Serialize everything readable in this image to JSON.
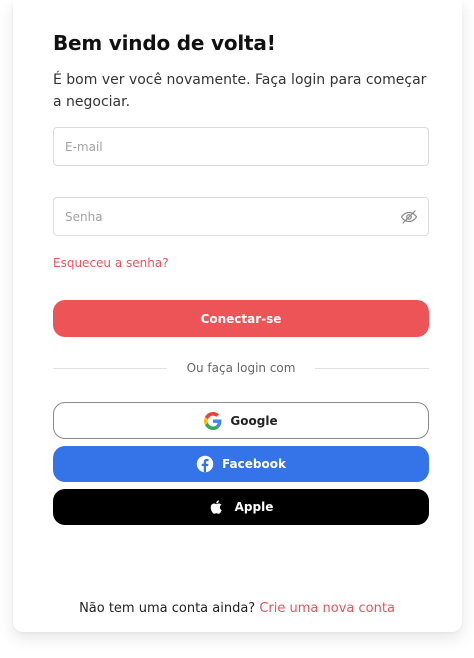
{
  "header": {
    "title": "Bem vindo de volta!",
    "subtitle": "É bom ver você novamente. Faça login para começar a negociar."
  },
  "form": {
    "email": {
      "placeholder": "E-mail",
      "value": ""
    },
    "password": {
      "placeholder": "Senha",
      "value": ""
    },
    "forgot_label": "Esqueceu a senha?",
    "connect_label": "Conectar-se"
  },
  "social": {
    "divider_label": "Ou faça login com",
    "google_label": "Google",
    "facebook_label": "Facebook",
    "apple_label": "Apple"
  },
  "footer": {
    "prompt": "Não tem uma conta ainda?",
    "signup_link": "Crie uma nova conta"
  },
  "icons": {
    "password_toggle": "eye-slash-icon",
    "google": "google-icon",
    "facebook": "facebook-icon",
    "apple": "apple-icon"
  },
  "colors": {
    "accent": "#ec5458",
    "link": "#e8555a",
    "facebook": "#3574e8",
    "apple": "#000000"
  }
}
